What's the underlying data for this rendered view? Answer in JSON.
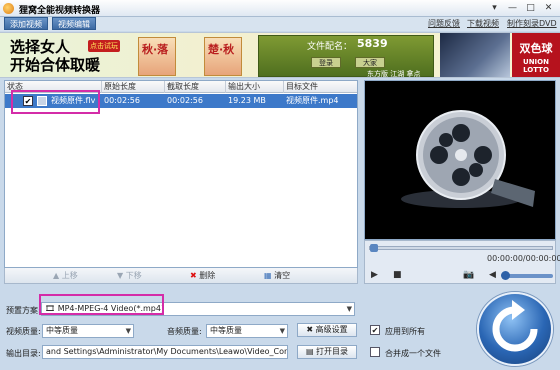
{
  "window": {
    "title": "狸窝全能视频转换器",
    "controls": [
      "▾",
      "—",
      "□",
      "✕"
    ]
  },
  "toolbar": {
    "add_video": "添加视频",
    "edit_video": "视频编辑",
    "links": [
      "问题反馈",
      "下载视频",
      "制作刻录DVD"
    ]
  },
  "banner": {
    "ad_line1": "选择女人",
    "ad_line2": "开始合体取暖",
    "ad_badge": "点击试玩",
    "card1": "秋·落",
    "card2": "楚·秋",
    "game_name": "文件配名：",
    "game_number": "5839",
    "game_btn1": "登录",
    "game_btn2": "大家",
    "game_bottom": "东方版 江湖 拿点",
    "lotto_big": "双色球",
    "lotto_small": "UNION LOTTO"
  },
  "table": {
    "headers": [
      "状态",
      "原始长度",
      "截取长度",
      "输出大小",
      "目标文件"
    ],
    "rows": [
      {
        "checked": "✔",
        "name": "视频原件.flv",
        "orig_len": "00:02:56",
        "cut_len": "00:02:56",
        "size": "19.23 MB",
        "target": "视频原件.mp4"
      }
    ]
  },
  "list_buttons": {
    "up": "上移",
    "down": "下移",
    "delete": "删除",
    "clear": "清空"
  },
  "player": {
    "time": "00:00:00/00:00:00",
    "play": "▶",
    "stop": "■",
    "snapshot": "📷"
  },
  "settings": {
    "preset_label": "预置方案:",
    "preset_value": "MP4-MPEG-4 Video(*.mp4)",
    "video_quality_label": "视频质量:",
    "video_quality_value": "中等质量",
    "audio_quality_label": "音频质量:",
    "audio_quality_value": "中等质量",
    "advanced_btn": "高级设置",
    "apply_all_label": "应用到所有",
    "apply_all_checked": "✔",
    "output_label": "输出目录:",
    "output_path": "and Settings\\Administrator\\My Documents\\Leawo\\Video_Conver",
    "open_dir_btn": "打开目录",
    "merge_label": "合并成一个文件"
  },
  "colors": {
    "selection": "#3d79c9",
    "highlight": "#d42ca8"
  }
}
